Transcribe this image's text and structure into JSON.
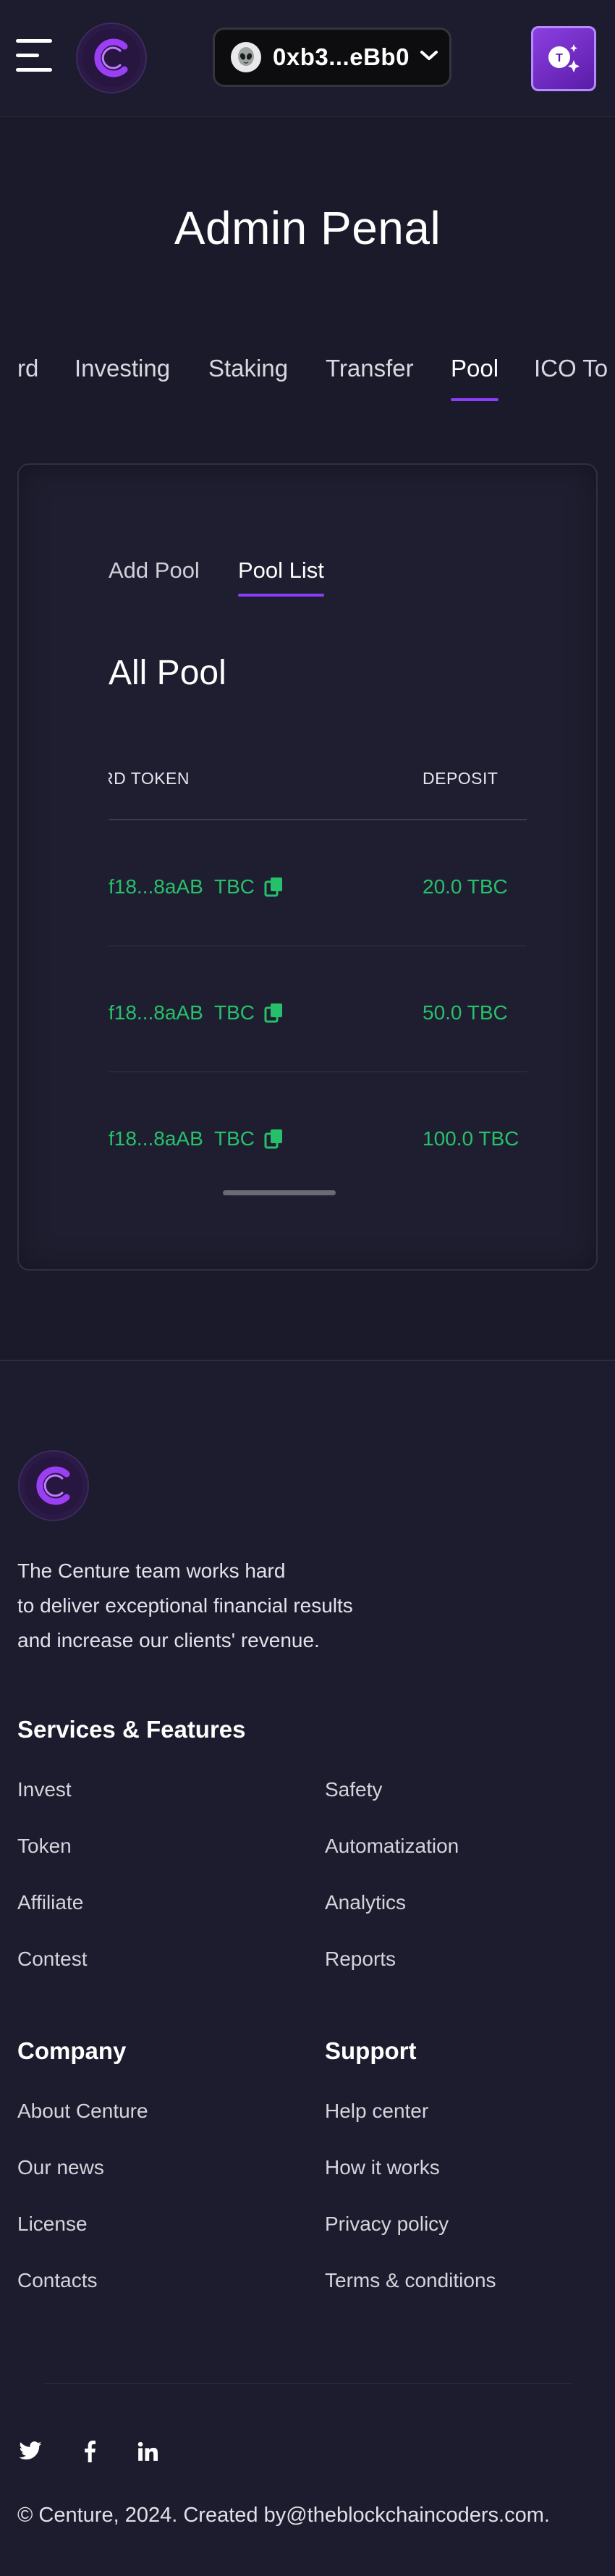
{
  "header": {
    "wallet_address": "0xb3...eBb0",
    "ai_button_letter": "T"
  },
  "page": {
    "title": "Admin Penal"
  },
  "admin_tabs": [
    "rd",
    "Investing",
    "Staking",
    "Transfer",
    "Pool",
    "ICO To"
  ],
  "admin_tabs_active": "Pool",
  "pool": {
    "sub_tabs": [
      "Add Pool",
      "Pool List"
    ],
    "sub_tabs_active": "Pool List",
    "section_title": "All Pool",
    "columns": [
      "RD TOKEN",
      "DEPOSIT"
    ],
    "rows": [
      {
        "token_address": "f18...8aAB",
        "token_symbol": "TBC",
        "deposit": "20.0 TBC"
      },
      {
        "token_address": "f18...8aAB",
        "token_symbol": "TBC",
        "deposit": "50.0 TBC"
      },
      {
        "token_address": "f18...8aAB",
        "token_symbol": "TBC",
        "deposit": "100.0 TBC"
      }
    ]
  },
  "footer": {
    "about_lines": [
      "The Centure team works hard",
      "to deliver exceptional financial results",
      "and increase our clients' revenue."
    ],
    "services": {
      "title": "Services & Features",
      "left": [
        "Invest",
        "Token",
        "Affiliate",
        "Contest"
      ],
      "right": [
        "Safety",
        "Automatization",
        "Analytics",
        "Reports"
      ]
    },
    "company": {
      "title": "Company",
      "links": [
        "About Centure",
        "Our news",
        "License",
        "Contacts"
      ]
    },
    "support": {
      "title": "Support",
      "links": [
        "Help center",
        "How it works",
        "Privacy policy",
        "Terms & conditions"
      ]
    },
    "social_icons": [
      "twitter-icon",
      "facebook-icon",
      "linkedin-icon"
    ],
    "copyright": "© Centure, 2024. Created by@theblockchaincoders.com."
  },
  "colors": {
    "background": "#1a1a2b",
    "accent": "#8b3df7",
    "positive": "#27c06a"
  }
}
